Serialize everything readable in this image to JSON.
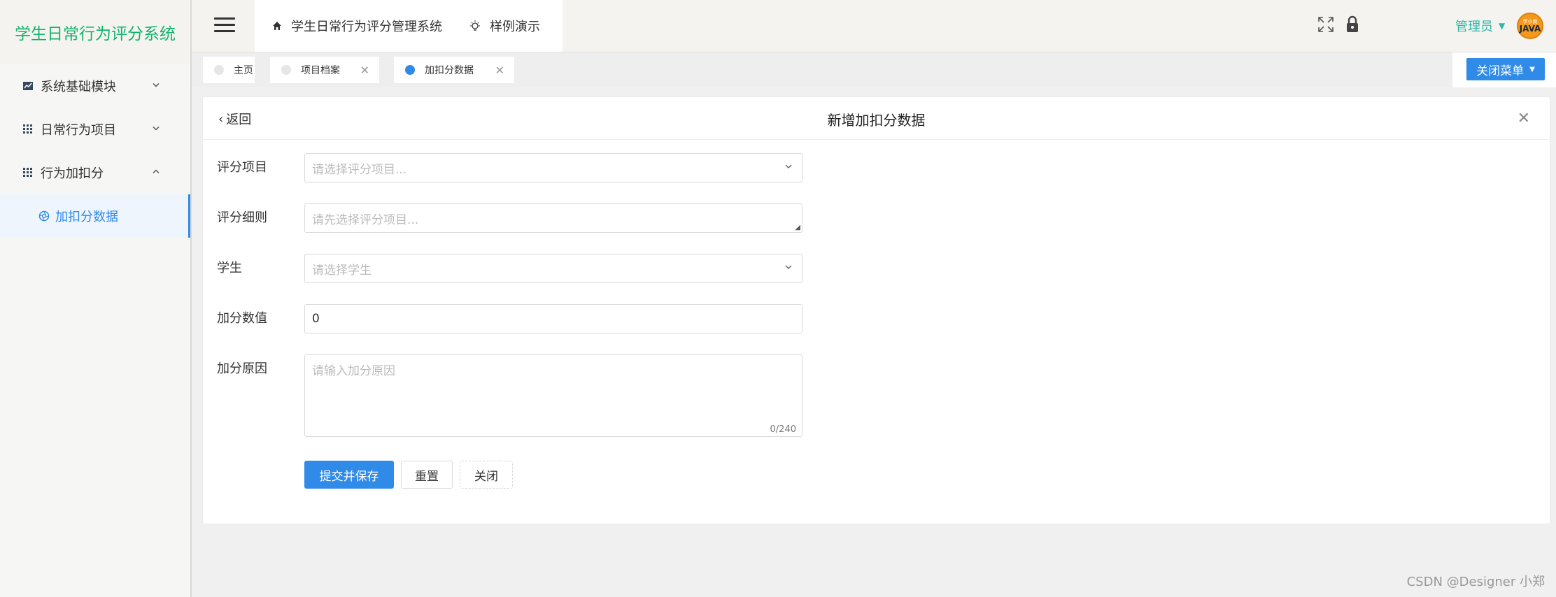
{
  "brand": "学生日常行为评分系统",
  "sidebar": {
    "items": [
      {
        "label": "系统基础模块",
        "icon": "chart-icon",
        "expanded": false
      },
      {
        "label": "日常行为项目",
        "icon": "grid-icon",
        "expanded": false
      },
      {
        "label": "行为加扣分",
        "icon": "grid-icon",
        "expanded": true
      }
    ],
    "sub_item": {
      "label": "加扣分数据",
      "icon": "aperture-icon"
    }
  },
  "header": {
    "nav": [
      {
        "label": "学生日常行为评分管理系统",
        "icon": "home-icon"
      },
      {
        "label": "样例演示",
        "icon": "bulb-icon"
      }
    ],
    "admin_label": "管理员",
    "avatar_top": "学小疯",
    "avatar_main": "JAVA"
  },
  "tabs": [
    {
      "label": "主页",
      "closable": false,
      "active": false
    },
    {
      "label": "项目档案",
      "closable": true,
      "active": false
    },
    {
      "label": "加扣分数据",
      "closable": true,
      "active": true
    }
  ],
  "close_menu_label": "关闭菜单",
  "panel": {
    "back_label": "返回",
    "title": "新增加扣分数据",
    "fields": [
      {
        "label": "评分项目",
        "placeholder": "请选择评分项目...",
        "type": "select"
      },
      {
        "label": "评分细则",
        "placeholder": "请先选择评分项目...",
        "type": "textarea-small"
      },
      {
        "label": "学生",
        "placeholder": "请选择学生",
        "type": "select"
      },
      {
        "label": "加分数值",
        "value": "0",
        "type": "input"
      },
      {
        "label": "加分原因",
        "placeholder": "请输入加分原因",
        "type": "textarea",
        "counter": "0/240"
      }
    ],
    "buttons": {
      "submit": "提交并保存",
      "reset": "重置",
      "close": "关闭"
    }
  },
  "watermark": "CSDN @Designer 小郑",
  "colors": {
    "accent": "#2f8ae8",
    "brand": "#13b36b",
    "admin": "#2db7a7"
  }
}
